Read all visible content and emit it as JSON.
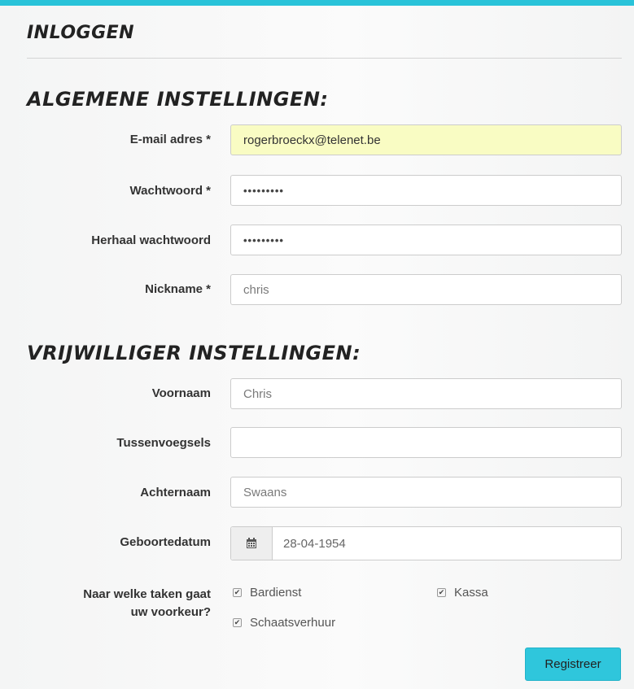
{
  "header": {
    "title": "INLOGGEN"
  },
  "general_section": {
    "heading": "ALGEMENE INSTELLINGEN:",
    "email": {
      "label": "E-mail adres *",
      "value": "rogerbroeckx@telenet.be"
    },
    "password": {
      "label": "Wachtwoord *",
      "value": "•••••••••"
    },
    "password_repeat": {
      "label": "Herhaal wachtwoord",
      "value": "•••••••••"
    },
    "nickname": {
      "label": "Nickname *",
      "value": "chris"
    }
  },
  "volunteer_section": {
    "heading": "VRIJWILLIGER INSTELLINGEN:",
    "first_name": {
      "label": "Voornaam",
      "value": "Chris"
    },
    "infix": {
      "label": "Tussenvoegsels",
      "value": ""
    },
    "last_name": {
      "label": "Achternaam",
      "value": "Swaans"
    },
    "birth_date": {
      "label": "Geboortedatum",
      "value": "28-04-1954",
      "icon": "calendar-icon"
    },
    "preferences": {
      "label_line1": "Naar welke taken gaat",
      "label_line2": "uw voorkeur?",
      "options": [
        {
          "label": "Bardienst",
          "checked": true
        },
        {
          "label": "Kassa",
          "checked": true
        },
        {
          "label": "Schaatsverhuur",
          "checked": true
        }
      ]
    }
  },
  "actions": {
    "submit_label": "Registreer"
  },
  "colors": {
    "accent": "#2fc6dc",
    "autofill": "#f9fcc3"
  }
}
